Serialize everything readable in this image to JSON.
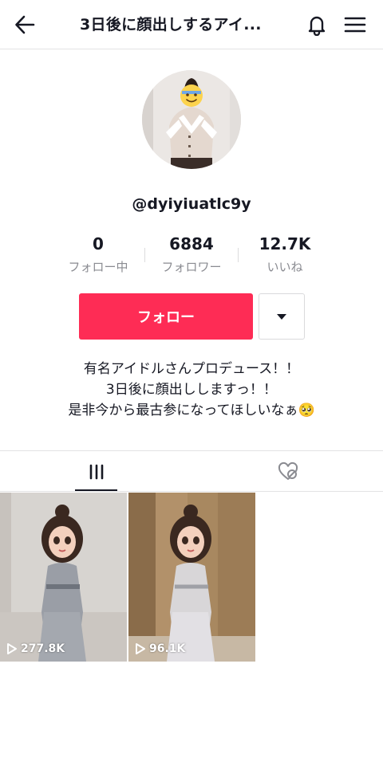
{
  "header": {
    "title": "3日後に顔出しするアイ...",
    "back_icon": "arrow-left-icon",
    "bell_icon": "bell-icon",
    "menu_icon": "hamburger-menu-icon"
  },
  "profile": {
    "username": "@dyiyiuatlc9y",
    "stats": [
      {
        "value": "0",
        "label": "フォロー中"
      },
      {
        "value": "6884",
        "label": "フォロワー"
      },
      {
        "value": "12.7K",
        "label": "いいね"
      }
    ],
    "follow_label": "フォロー",
    "bio": [
      "有名アイドルさんプロデュース！！",
      "3日後に顔出ししますっ！！",
      "是非今から最古参になってほしいなぁ🥺"
    ]
  },
  "tabs": {
    "videos_icon": "video-grid-icon",
    "liked_icon": "hidden-liked-icon"
  },
  "videos": [
    {
      "plays": "277.8K"
    },
    {
      "plays": "96.1K"
    }
  ],
  "colors": {
    "accent": "#fe2c55",
    "text": "#161823",
    "secondary": "#8a8b91"
  }
}
